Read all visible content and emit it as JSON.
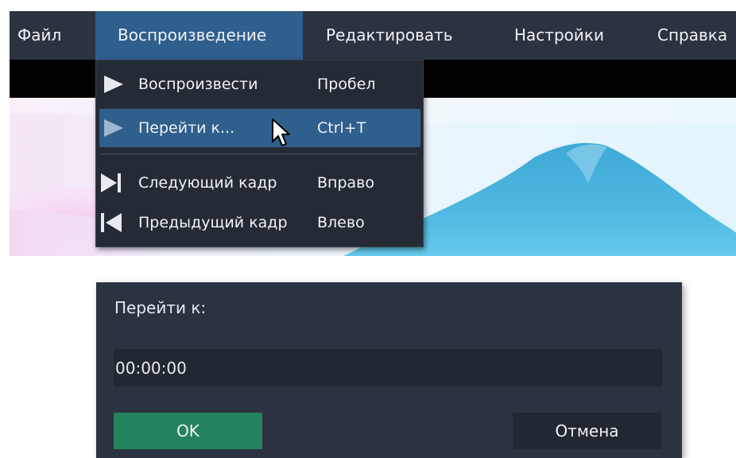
{
  "menubar": {
    "items": [
      {
        "label": "Файл"
      },
      {
        "label": "Воспроизведение"
      },
      {
        "label": "Редактировать"
      },
      {
        "label": "Настройки"
      },
      {
        "label": "Справка"
      }
    ],
    "active_index": 1,
    "colors": {
      "bar": "#2c3340",
      "active": "#2f5f8d"
    }
  },
  "playback_menu": {
    "items": [
      {
        "label": "Воспроизвести",
        "shortcut": "Пробел",
        "icon": "play-icon"
      },
      {
        "label": "Перейти к...",
        "shortcut": "Ctrl+T",
        "icon": "play-icon",
        "highlighted": true
      },
      {
        "label": "Следующий кадр",
        "shortcut": "Вправо",
        "icon": "next-frame-icon"
      },
      {
        "label": "Предыдущий кадр",
        "shortcut": "Влево",
        "icon": "previous-frame-icon"
      }
    ]
  },
  "goto_dialog": {
    "title": "Перейти к:",
    "time_value": "00:00:00",
    "ok_label": "OK",
    "cancel_label": "Отмена",
    "colors": {
      "ok": "#23835c",
      "background": "#2c3340"
    }
  }
}
